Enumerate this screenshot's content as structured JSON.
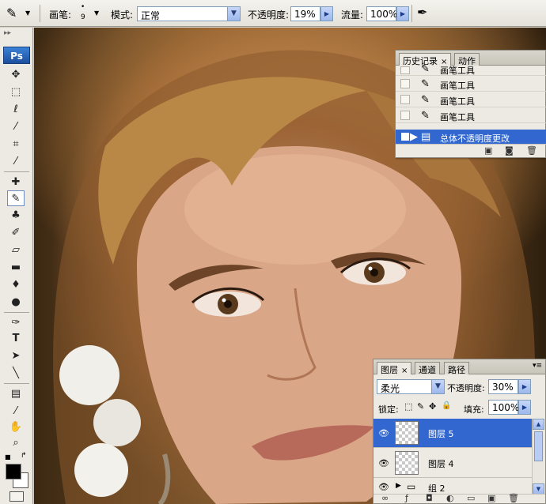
{
  "options_bar": {
    "brush_label": "画笔:",
    "brush_size": "9",
    "mode_label": "模式:",
    "mode_value": "正常",
    "opacity_label": "不透明度:",
    "opacity_value": "19%",
    "flow_label": "流量:",
    "flow_value": "100%"
  },
  "toolbox": {
    "logo": "Ps",
    "tools": [
      "move-icon",
      "marquee-icon",
      "lasso-icon",
      "magic-wand-icon",
      "crop-icon",
      "slice-icon",
      "healing-brush-icon",
      "brush-icon",
      "clone-stamp-icon",
      "history-brush-icon",
      "eraser-icon",
      "gradient-icon",
      "blur-icon",
      "dodge-icon",
      "pen-icon",
      "type-icon",
      "path-selection-icon",
      "line-icon",
      "notes-icon",
      "eyedropper-icon",
      "hand-icon",
      "zoom-icon"
    ],
    "foreground_color": "#000000",
    "background_color": "#ffffff"
  },
  "history_panel": {
    "tabs": [
      {
        "label": "历史记录",
        "active": true
      },
      {
        "label": "动作",
        "active": false
      }
    ],
    "items": [
      {
        "label": "画笔工具",
        "selected": false
      },
      {
        "label": "画笔工具",
        "selected": false
      },
      {
        "label": "画笔工具",
        "selected": false
      },
      {
        "label": "画笔工具",
        "selected": false
      },
      {
        "label": "总体不透明度更改",
        "selected": true
      }
    ]
  },
  "layers_panel": {
    "tabs": [
      {
        "label": "图层",
        "active": true
      },
      {
        "label": "通道",
        "active": false
      },
      {
        "label": "路径",
        "active": false
      }
    ],
    "blend_mode": "柔光",
    "opacity_label": "不透明度:",
    "opacity_value": "30%",
    "lock_label": "锁定:",
    "fill_label": "填充:",
    "fill_value": "100%",
    "layers": [
      {
        "name": "图层 5",
        "selected": true,
        "type": "layer"
      },
      {
        "name": "图层 4",
        "selected": false,
        "type": "layer"
      },
      {
        "name": "组 2",
        "selected": false,
        "type": "group"
      }
    ]
  },
  "colors": {
    "selection": "#3167ce",
    "panel_bg": "#eceae2"
  }
}
